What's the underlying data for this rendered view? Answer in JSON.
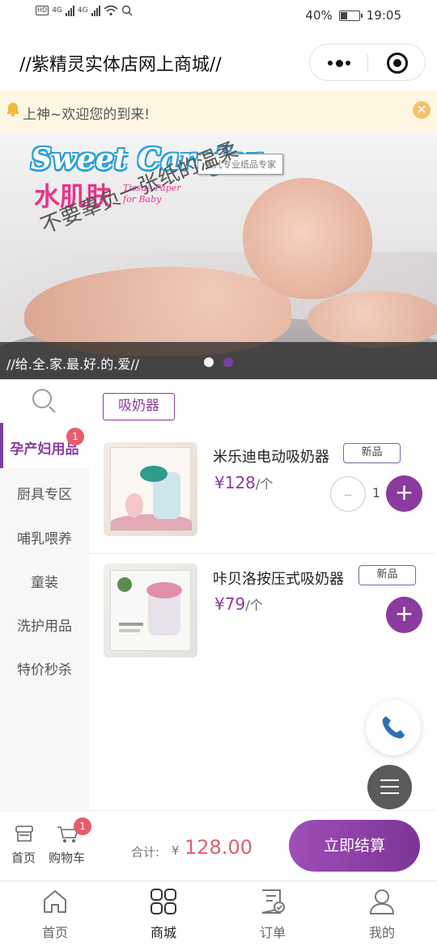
{
  "status_bar": {
    "network": "4G",
    "battery": "40%",
    "battery_level": 0.4,
    "time": "19:05"
  },
  "title_bar": {
    "title": "//紫精灵实体店网上商城//"
  },
  "notice": {
    "text": "上神~欢迎您的到来!"
  },
  "banner": {
    "brand_en": "Sweet Carefor",
    "brand_cn": "水肌肤",
    "brand_sub": "Tissue Paper for Baby",
    "brand_tag": "婴儿专业纸品专家",
    "slogan": "不要辜负一张纸的温柔",
    "caption": "//给.全.家.最.好.的.爱//",
    "active_slide": 1,
    "slide_count": 2
  },
  "categories": [
    {
      "label": "孕产妇用品",
      "active": true,
      "badge": "1"
    },
    {
      "label": "厨具专区"
    },
    {
      "label": "哺乳喂养"
    },
    {
      "label": "童装"
    },
    {
      "label": "洗护用品"
    },
    {
      "label": "特价秒杀"
    }
  ],
  "subcategory": "吸奶器",
  "products": [
    {
      "name": "米乐迪电动吸奶器",
      "tag": "新品",
      "currency": "¥",
      "price": "128",
      "unit": "/个",
      "qty": "1",
      "qty_minus": "‒",
      "add_label": "+"
    },
    {
      "name": "咔贝洛按压式吸奶器",
      "tag": "新品",
      "currency": "¥",
      "price": "79",
      "unit": "/个",
      "add_label": "+"
    }
  ],
  "cart_bar": {
    "home_label": "首页",
    "cart_label": "购物车",
    "cart_badge": "1",
    "total_label": "合计:",
    "total_currency": "¥",
    "total_value": "128.00",
    "checkout_label": "立即结算"
  },
  "tab_bar": {
    "tabs": [
      {
        "label": "首页",
        "icon": "home-icon"
      },
      {
        "label": "商城",
        "icon": "grid-icon",
        "active": true
      },
      {
        "label": "订单",
        "icon": "order-icon"
      },
      {
        "label": "我的",
        "icon": "user-icon"
      }
    ]
  },
  "colors": {
    "accent": "#8a3b9e",
    "badge": "#e85c6b",
    "price_total": "#e06070",
    "notice_bg": "#fdf7e2"
  }
}
